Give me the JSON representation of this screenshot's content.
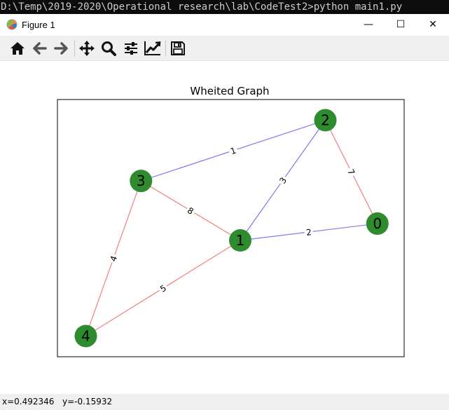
{
  "console": {
    "text": "D:\\Temp\\2019-2020\\Operational research\\lab\\CodeTest2>python main1.py"
  },
  "window": {
    "title": "Figure 1",
    "controls": {
      "minimize": "—",
      "maximize": "☐",
      "close": "✕"
    }
  },
  "toolbar": {
    "buttons": [
      {
        "name": "home-button",
        "icon": "home-icon"
      },
      {
        "name": "back-button",
        "icon": "arrow-left-icon"
      },
      {
        "name": "forward-button",
        "icon": "arrow-right-icon"
      },
      {
        "name": "pan-button",
        "icon": "move-icon"
      },
      {
        "name": "zoom-button",
        "icon": "magnifier-icon"
      },
      {
        "name": "configure-subplots-button",
        "icon": "sliders-icon"
      },
      {
        "name": "edit-axes-button",
        "icon": "line-chart-icon"
      },
      {
        "name": "save-button",
        "icon": "floppy-disk-icon"
      }
    ]
  },
  "chart_data": {
    "type": "network-graph",
    "title": "Wheited Graph",
    "node_color": "#2e8b2e",
    "nodes": [
      {
        "id": "0",
        "x": 0.95,
        "y": 0.15
      },
      {
        "id": "1",
        "x": 0.08,
        "y": 0.02
      },
      {
        "id": "2",
        "x": 0.62,
        "y": 0.95
      },
      {
        "id": "3",
        "x": -0.55,
        "y": 0.48
      },
      {
        "id": "4",
        "x": -0.9,
        "y": -0.72
      }
    ],
    "edges": [
      {
        "source": "2",
        "target": "0",
        "weight": "7",
        "color": "#f08080"
      },
      {
        "source": "3",
        "target": "2",
        "weight": "1",
        "color": "#7b7bf0"
      },
      {
        "source": "1",
        "target": "2",
        "weight": "3",
        "color": "#7b7bf0"
      },
      {
        "source": "1",
        "target": "0",
        "weight": "2",
        "color": "#7b7bf0"
      },
      {
        "source": "3",
        "target": "1",
        "weight": "8",
        "color": "#f08080"
      },
      {
        "source": "3",
        "target": "4",
        "weight": "4",
        "color": "#f08080"
      },
      {
        "source": "4",
        "target": "1",
        "weight": "5",
        "color": "#f08080"
      }
    ],
    "xlim": [
      -1.08,
      1.12
    ],
    "ylim": [
      -0.88,
      1.11
    ]
  },
  "status": {
    "x": "x=0.492346",
    "y": "y=-0.15932"
  }
}
